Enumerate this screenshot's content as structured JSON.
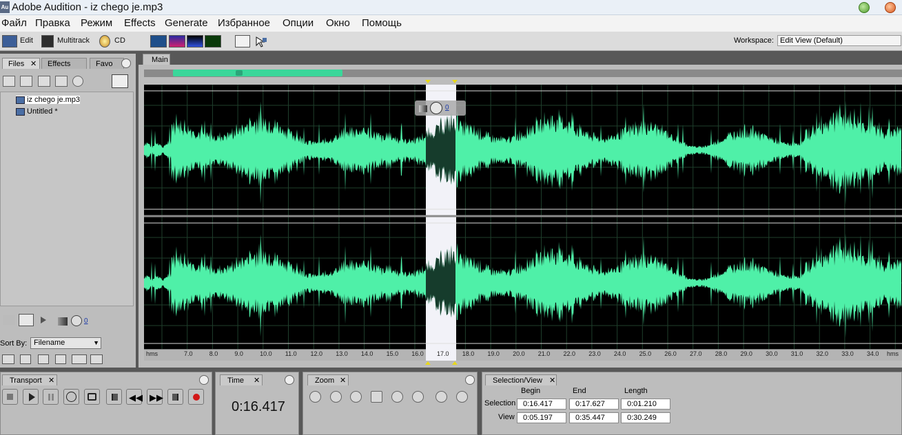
{
  "app": {
    "title": "Adobe Audition - iz chego je.mp3",
    "icon_text": "Au"
  },
  "menu": [
    "Файл",
    "Правка",
    "Режим",
    "Effects",
    "Generate",
    "Избранное",
    "Опции",
    "Окно",
    "Помощь"
  ],
  "toolbar": {
    "edit_label": "Edit",
    "multitrack_label": "Multitrack",
    "cd_label": "CD",
    "workspace_label": "Workspace:",
    "workspace_value": "Edit View (Default)"
  },
  "left_panel": {
    "tabs": [
      "Files",
      "Effects",
      "Favo"
    ],
    "files": [
      "iz chego je.mp3",
      "Untitled *"
    ],
    "volume_value": "0",
    "sort_by_label": "Sort By:",
    "sort_by_value": "Filename"
  },
  "main": {
    "tab_label": "Main",
    "level_value": "0",
    "ruler_unit": "hms",
    "ruler_ticks": [
      "7.0",
      "8.0",
      "9.0",
      "10.0",
      "11.0",
      "12.0",
      "13.0",
      "14.0",
      "15.0",
      "16.0",
      "17.0",
      "18.0",
      "19.0",
      "20.0",
      "21.0",
      "22.0",
      "23.0",
      "24.0",
      "25.0",
      "26.0",
      "27.0",
      "28.0",
      "29.0",
      "30.0",
      "31.0",
      "32.0",
      "33.0",
      "34.0"
    ],
    "waveform_color": "#4ff0a8",
    "selection_color": "#f2f2f8"
  },
  "transport": {
    "label": "Transport"
  },
  "time": {
    "label": "Time",
    "value": "0:16.417"
  },
  "zoom": {
    "label": "Zoom"
  },
  "selection_view": {
    "label": "Selection/View",
    "headers": [
      "Begin",
      "End",
      "Length"
    ],
    "selection_label": "Selection",
    "view_label": "View",
    "selection": [
      "0:16.417",
      "0:17.627",
      "0:01.210"
    ],
    "view": [
      "0:05.197",
      "0:35.447",
      "0:30.249"
    ]
  }
}
